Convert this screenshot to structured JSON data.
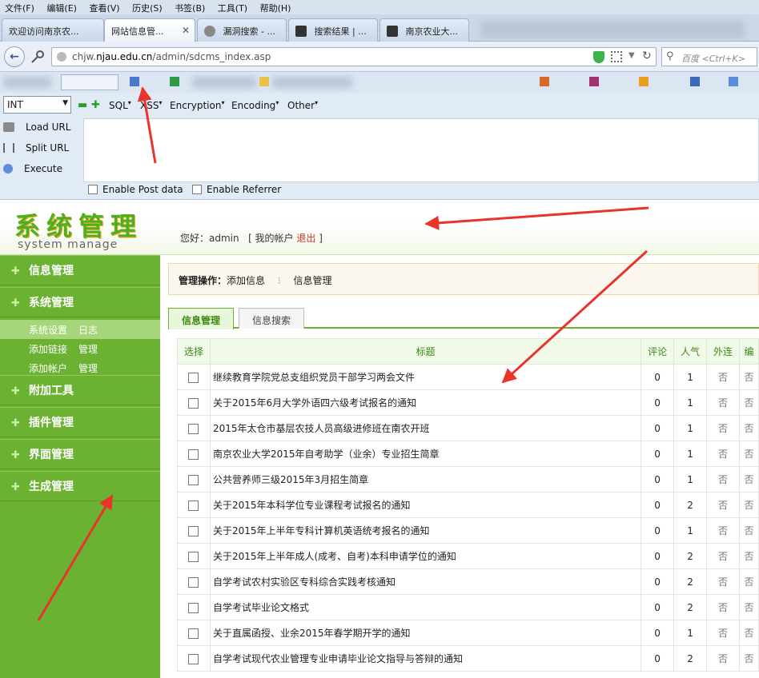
{
  "browser": {
    "menu": [
      "文件(F)",
      "编辑(E)",
      "查看(V)",
      "历史(S)",
      "书签(B)",
      "工具(T)",
      "帮助(H)"
    ],
    "tabs": [
      "欢迎访问南京农...",
      "网站信息管...",
      "漏洞搜索 - ...",
      "搜索结果 | ...",
      "南京农业大..."
    ],
    "url_prefix": "chjw.",
    "url_host": "njau.edu.cn",
    "url_path": "/admin/sdcms_index.asp",
    "search_placeholder": "百度 <Ctrl+K>"
  },
  "hackbar": {
    "select_value": "INT",
    "menus": [
      "SQL",
      "XSS",
      "Encryption",
      "Encoding",
      "Other"
    ],
    "load_url": "Load URL",
    "split_url": "Split URL",
    "execute": "Execute",
    "post_data": "Enable Post data",
    "referrer": "Enable Referrer"
  },
  "cms": {
    "logo_cn": "系统管理",
    "logo_en": "system manage",
    "greeting": "您好：admin",
    "account_open": "[ 我的帐户",
    "logout": "退出",
    "account_close": "]"
  },
  "sidebar": {
    "groups": [
      "信息管理",
      "系统管理",
      "附加工具",
      "插件管理",
      "界面管理",
      "生成管理"
    ],
    "subs": [
      [
        "系统设置",
        "日志"
      ],
      [
        "添加链接",
        "管理"
      ],
      [
        "添加帐户",
        "管理"
      ]
    ]
  },
  "main": {
    "ops_label": "管理操作：",
    "ops_add": "添加信息",
    "ops_sep": "⁝",
    "ops_manage": "信息管理",
    "tabs": [
      "信息管理",
      "信息搜索"
    ],
    "columns": [
      "选择",
      "标题",
      "评论",
      "人气",
      "外连",
      "编"
    ],
    "rows": [
      {
        "title": "继续教育学院党总支组织党员干部学习两会文件",
        "comments": "0",
        "views": "1",
        "external": "否",
        "extra": "否"
      },
      {
        "title": "关于2015年6月大学外语四六级考试报名的通知",
        "comments": "0",
        "views": "1",
        "external": "否",
        "extra": "否"
      },
      {
        "title": "2015年太仓市基层农技人员高级进修班在南农开班",
        "comments": "0",
        "views": "1",
        "external": "否",
        "extra": "否"
      },
      {
        "title": "南京农业大学2015年自考助学（业余）专业招生简章",
        "comments": "0",
        "views": "1",
        "external": "否",
        "extra": "否"
      },
      {
        "title": "公共营养师三级2015年3月招生简章",
        "comments": "0",
        "views": "1",
        "external": "否",
        "extra": "否"
      },
      {
        "title": "关于2015年本科学位专业课程考试报名的通知",
        "comments": "0",
        "views": "2",
        "external": "否",
        "extra": "否"
      },
      {
        "title": "关于2015年上半年专科计算机英语统考报名的通知",
        "comments": "0",
        "views": "1",
        "external": "否",
        "extra": "否"
      },
      {
        "title": "关于2015年上半年成人(成考、自考)本科申请学位的通知",
        "comments": "0",
        "views": "2",
        "external": "否",
        "extra": "否"
      },
      {
        "title": "自学考试农村实验区专科综合实践考核通知",
        "comments": "0",
        "views": "2",
        "external": "否",
        "extra": "否"
      },
      {
        "title": "自学考试毕业论文格式",
        "comments": "0",
        "views": "2",
        "external": "否",
        "extra": "否"
      },
      {
        "title": "关于直属函授、业余2015年春学期开学的通知",
        "comments": "0",
        "views": "1",
        "external": "否",
        "extra": "否"
      },
      {
        "title": "自学考试现代农业管理专业申请毕业论文指导与答辩的通知",
        "comments": "0",
        "views": "2",
        "external": "否",
        "extra": "否"
      }
    ]
  },
  "colors": {
    "sidebar": "#6cb232",
    "arrow": "#e8342a",
    "logo": "#4db11f"
  }
}
